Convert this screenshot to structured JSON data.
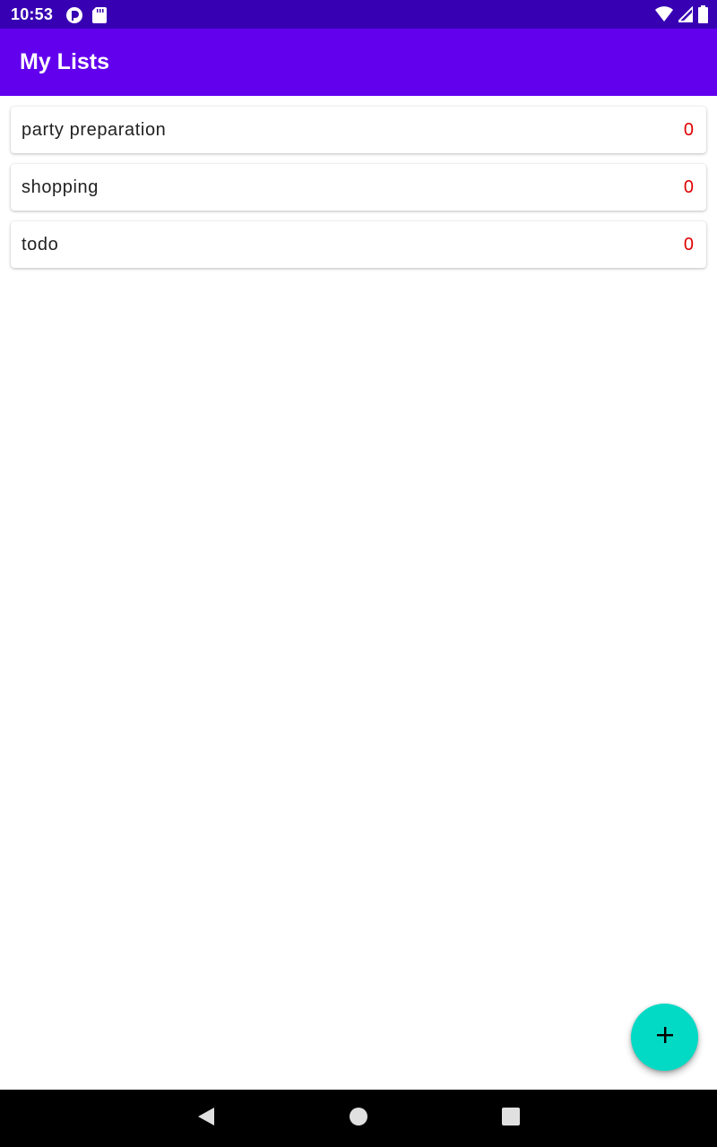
{
  "status_bar": {
    "time": "10:53",
    "icons": [
      "sync-icon",
      "sd-card-icon",
      "wifi-icon",
      "signal-icon",
      "battery-icon"
    ]
  },
  "app_bar": {
    "title": "My Lists"
  },
  "lists": [
    {
      "name": "party preparation",
      "count": "0"
    },
    {
      "name": "shopping",
      "count": "0"
    },
    {
      "name": "todo",
      "count": "0"
    }
  ],
  "fab": {
    "icon": "plus-icon"
  },
  "nav_bar": {
    "icons": [
      "back-icon",
      "home-icon",
      "recents-icon"
    ]
  },
  "colors": {
    "status_bar": "#3700b3",
    "app_bar": "#6200ee",
    "fab": "#03dac5",
    "count_text": "#e00000"
  }
}
